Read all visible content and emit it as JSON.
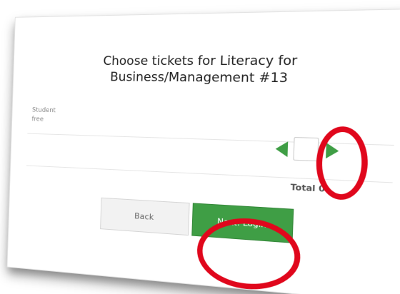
{
  "dialog": {
    "title_line1": "Choose tickets for Literacy for",
    "title_line2": "Business/Management #13"
  },
  "ticket": {
    "name": "Student",
    "price": "free",
    "quantity": ""
  },
  "summary": {
    "total_label": "Total 0"
  },
  "buttons": {
    "back_label": "Back",
    "next_label": "Next: Login"
  },
  "icons": {
    "decrease": "left-arrow-icon",
    "increase": "right-arrow-icon"
  },
  "colors": {
    "primary_green": "#3f9e45",
    "highlight_red": "#e0071c",
    "back_button_bg": "#f2f2f2"
  }
}
